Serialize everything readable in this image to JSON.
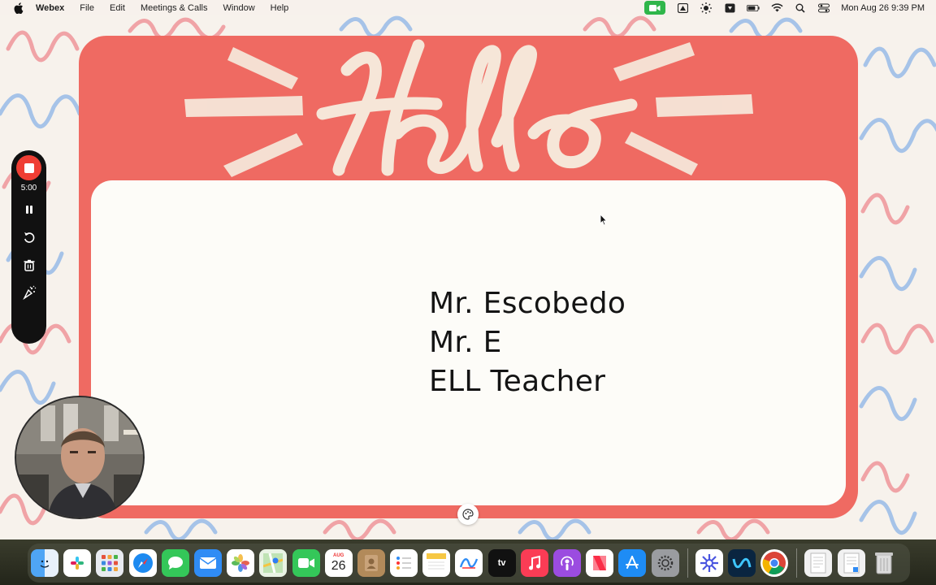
{
  "menubar": {
    "app_name": "Webex",
    "items": [
      "File",
      "Edit",
      "Meetings & Calls",
      "Window",
      "Help"
    ],
    "clock": "Mon Aug 26  9:39 PM",
    "status_icons": [
      "video-camera-icon",
      "google-drive-icon",
      "brightness-icon",
      "dropbox-icon",
      "battery-icon",
      "wifi-icon",
      "search-icon",
      "control-center-icon"
    ]
  },
  "slide": {
    "header_word": "Hello",
    "lines": [
      "Mr. Escobedo",
      "Mr. E",
      "ELL Teacher"
    ],
    "colors": {
      "card": "#ef6a62",
      "panel": "#fdfcf8",
      "lettering": "#f6e6d8"
    }
  },
  "recorder": {
    "timer": "5:00",
    "controls": [
      "stop-record-icon",
      "pause-icon",
      "restart-icon",
      "trash-icon",
      "effects-icon"
    ],
    "stop_color": "#ef3e34"
  },
  "dock": {
    "calendar_month": "AUG",
    "calendar_day": "26",
    "apps": [
      "Finder",
      "Slack",
      "Launchpad",
      "Safari",
      "Messages",
      "Mail",
      "Photos",
      "Maps",
      "FaceTime",
      "Calendar",
      "Contacts",
      "Reminders",
      "Notes",
      "Freeform",
      "TV",
      "Music",
      "Podcasts",
      "News",
      "App Store",
      "System Settings",
      "Perplexity",
      "Webex",
      "Chrome",
      "Document 1",
      "Document 2",
      "Trash"
    ]
  }
}
